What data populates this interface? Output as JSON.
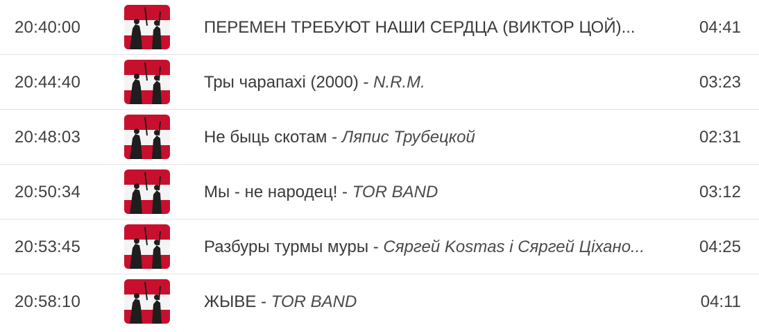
{
  "playlist": {
    "rows": [
      {
        "time": "20:40:00",
        "title": "ПЕРЕМЕН ТРЕБУЮТ НАШИ СЕРДЦА (ВИКТОР ЦОЙ)...",
        "separator": "",
        "artist": "",
        "duration": "04:41",
        "cover_icon": "album-cover-image"
      },
      {
        "time": "20:44:40",
        "title": "Тры чарапахі (2000)",
        "separator": " - ",
        "artist": "N.R.M.",
        "duration": "03:23",
        "cover_icon": "album-cover-image"
      },
      {
        "time": "20:48:03",
        "title": "Не быць скотам",
        "separator": " - ",
        "artist": "Ляпис Трубецкой",
        "duration": "02:31",
        "cover_icon": "album-cover-image"
      },
      {
        "time": "20:50:34",
        "title": "Мы - не народец!",
        "separator": " - ",
        "artist": "TOR BAND",
        "duration": "03:12",
        "cover_icon": "album-cover-image"
      },
      {
        "time": "20:53:45",
        "title": "Разбуры турмы муры",
        "separator": " - ",
        "artist": "Сяргей Kosmas і Сяргей Ціхано...",
        "duration": "04:25",
        "cover_icon": "album-cover-image"
      },
      {
        "time": "20:58:10",
        "title": "ЖЫВЕ",
        "separator": " - ",
        "artist": "TOR BAND",
        "duration": "04:11",
        "cover_icon": "album-cover-image"
      }
    ]
  },
  "colors": {
    "flag_red": "#c8102e",
    "flag_white": "#f4f4f4",
    "divider": "#e3e3e3",
    "text": "#3a3a3a"
  }
}
